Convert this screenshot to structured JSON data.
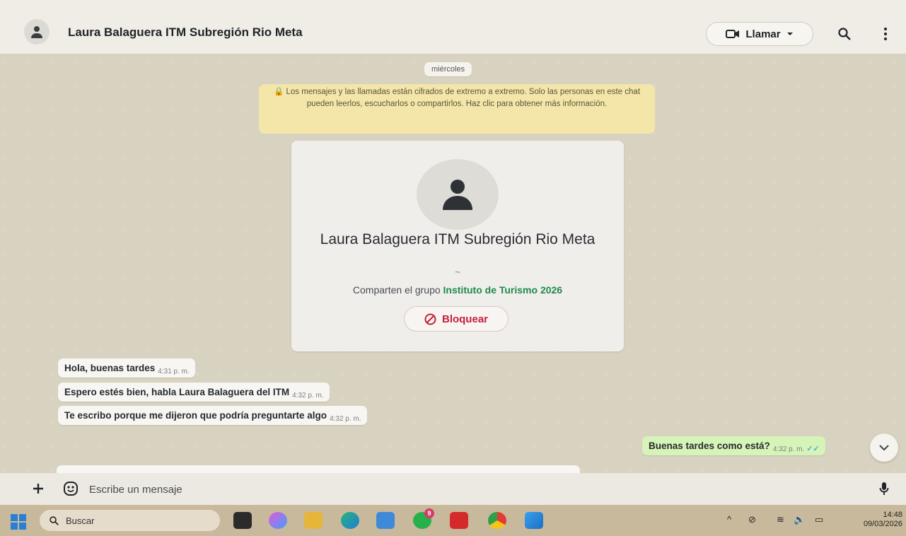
{
  "header": {
    "contact_name": "Laura Balaguera ITM Subregión Rio Meta",
    "call_label": "Llamar",
    "icons": [
      "avatar-icon",
      "video-icon",
      "chevron-down-icon",
      "search-icon",
      "more-icon"
    ]
  },
  "chat": {
    "day_label": "miércoles",
    "encryption_notice": "Los mensajes y las llamadas están cifrados de extremo a extremo. Solo las personas en este chat pueden leerlos, escucharlos o compartirlos. Haz clic para obtener más información.",
    "profile_card": {
      "name": "Laura Balaguera ITM Subregión Rio Meta",
      "subtitle": "~",
      "shared_prefix": "Comparten el grupo",
      "shared_group": "Instituto de Turismo 2026",
      "block_label": "Bloquear"
    },
    "messages": [
      {
        "direction": "in",
        "text": "Hola, buenas tardes",
        "time": "4:31 p. m."
      },
      {
        "direction": "in",
        "text": "Espero estés bien, habla Laura Balaguera del ITM",
        "time": "4:32 p. m."
      },
      {
        "direction": "in",
        "text": "Te escribo porque me dijeron que podría preguntarte algo",
        "time": "4:32 p. m."
      },
      {
        "direction": "out",
        "text": "Buenas tardes como está?",
        "time": "4:32 p. m.",
        "status": "read"
      }
    ]
  },
  "composer": {
    "placeholder": "Escribe un mensaje"
  },
  "taskbar": {
    "search_label": "Buscar",
    "badge_count": "9",
    "time": "14:48",
    "date": "09/03/2026"
  },
  "colors": {
    "chat_bg": "#d8d2c0",
    "outgoing_bubble": "#d6f4b8",
    "notice_bg": "#f4e6a8",
    "group_link": "#1f8a4c",
    "block_red": "#c2223b"
  }
}
